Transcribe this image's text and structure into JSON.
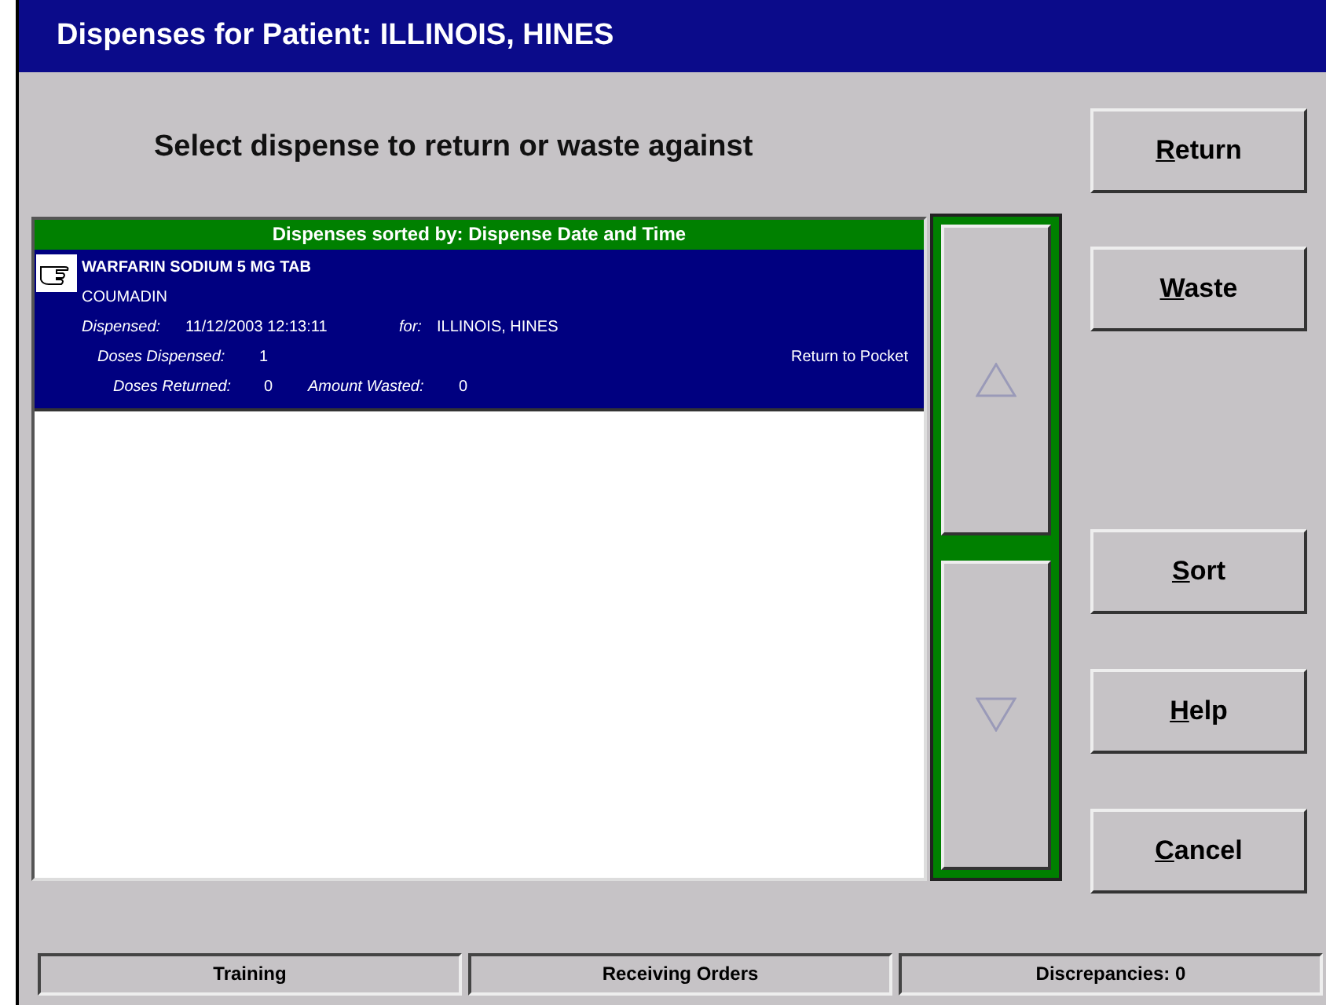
{
  "window": {
    "title": "Dispenses for Patient: ILLINOIS, HINES"
  },
  "prompt": "Select dispense to return or waste against",
  "list": {
    "header": "Dispenses sorted by: Dispense Date and Time",
    "rows": [
      {
        "selected": true,
        "drug": "WARFARIN SODIUM 5 MG TAB",
        "brand": "COUMADIN",
        "dispensed_label": "Dispensed:",
        "dispensed": "11/12/2003 12:13:11",
        "for_label": "for:",
        "for": "ILLINOIS, HINES",
        "doses_dispensed_label": "Doses Dispensed:",
        "doses_dispensed": "1",
        "destination": "Return to Pocket",
        "doses_returned_label": "Doses Returned:",
        "doses_returned": "0",
        "amount_wasted_label": "Amount Wasted:",
        "amount_wasted": "0"
      }
    ]
  },
  "buttons": [
    {
      "label": "Return"
    },
    {
      "label": "Waste"
    },
    {
      "label": "Sort"
    },
    {
      "label": "Help"
    },
    {
      "label": "Cancel"
    }
  ],
  "status_bar": [
    "Training",
    "Receiving Orders",
    "Discrepancies: 0"
  ]
}
